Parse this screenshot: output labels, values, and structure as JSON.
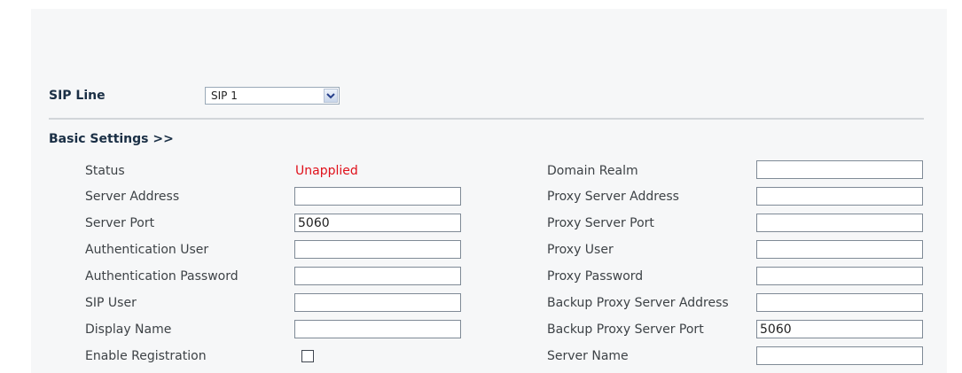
{
  "sip_line": {
    "label": "SIP Line",
    "selected": "SIP 1"
  },
  "basic_settings": {
    "title": "Basic Settings >>",
    "left_fields": [
      {
        "label": "Status",
        "value": "Unapplied"
      },
      {
        "label": "Server Address",
        "value": ""
      },
      {
        "label": "Server Port",
        "value": "5060"
      },
      {
        "label": "Authentication User",
        "value": ""
      },
      {
        "label": "Authentication Password",
        "value": ""
      },
      {
        "label": "SIP User",
        "value": ""
      },
      {
        "label": "Display Name",
        "value": ""
      },
      {
        "label": "Enable Registration",
        "checked": false
      }
    ],
    "right_fields": [
      {
        "label": "Domain Realm",
        "value": ""
      },
      {
        "label": "Proxy Server Address",
        "value": ""
      },
      {
        "label": "Proxy Server Port",
        "value": ""
      },
      {
        "label": "Proxy User",
        "value": ""
      },
      {
        "label": "Proxy Password",
        "value": ""
      },
      {
        "label": "Backup Proxy Server Address",
        "value": ""
      },
      {
        "label": "Backup Proxy Server Port",
        "value": "5060"
      },
      {
        "label": "Server Name",
        "value": ""
      }
    ]
  },
  "colors": {
    "status_unapplied": "#e0101a",
    "heading": "#1a2f45",
    "panel_background": "#f6f7f8"
  }
}
